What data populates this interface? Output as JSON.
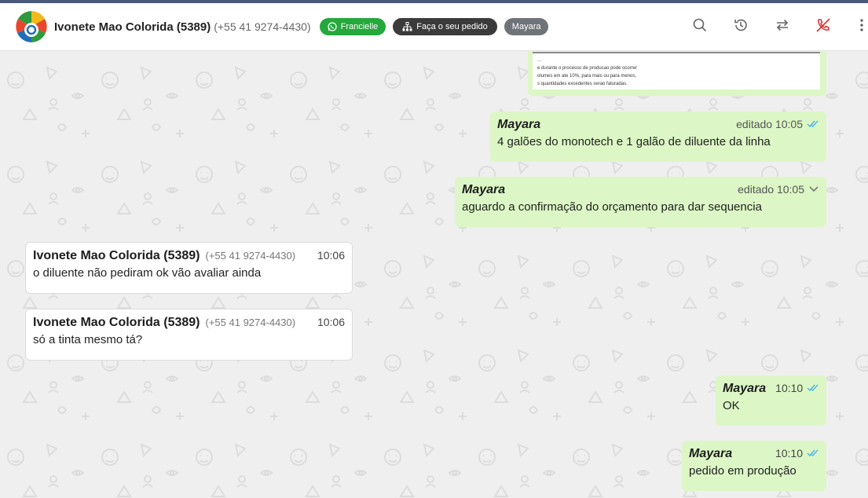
{
  "header": {
    "contact_name": "Ivonete Mao Colorida (5389)",
    "contact_phone": "(+55 41 9274-4430)",
    "tags": {
      "whatsapp": "Francielle",
      "order": "Faça o seu pedido",
      "agent": "Mayara"
    },
    "icons": [
      "search-icon",
      "history-icon",
      "transfer-icon",
      "end-chat-icon",
      "more-icon"
    ]
  },
  "doc_preview": {
    "lines": [
      "...",
      "e durante o processo de producao pode ocorrer",
      "olumes em ate 10%, para mais ou para menos,",
      "s quantidades excedentes serao faturadas."
    ]
  },
  "messages": [
    {
      "sender": "Mayara",
      "meta": "editado 10:05",
      "text": "4 galões do monotech e 1 galão de diluente da linha"
    },
    {
      "sender": "Mayara",
      "meta": "editado 10:05",
      "text": "aguardo a confirmação do orçamento para dar sequencia"
    },
    {
      "sender": "Ivonete Mao Colorida (5389)",
      "phone": "(+55 41 9274-4430)",
      "time": "10:06",
      "text": "o diluente não pediram ok vão avaliar ainda"
    },
    {
      "sender": "Ivonete Mao Colorida (5389)",
      "phone": "(+55 41 9274-4430)",
      "time": "10:06",
      "text": "só a tinta mesmo tá?"
    },
    {
      "sender": "Mayara",
      "time": "10:10",
      "text": "OK"
    },
    {
      "sender": "Mayara",
      "time": "10:10",
      "text": "pedido em produção"
    }
  ],
  "colors": {
    "outgoing_bubble": "#dcf7c5",
    "incoming_bubble": "#ffffff",
    "read_tick": "#4fb6ec",
    "tag_green": "#25a83c",
    "end_chat_icon": "#d9302f"
  }
}
